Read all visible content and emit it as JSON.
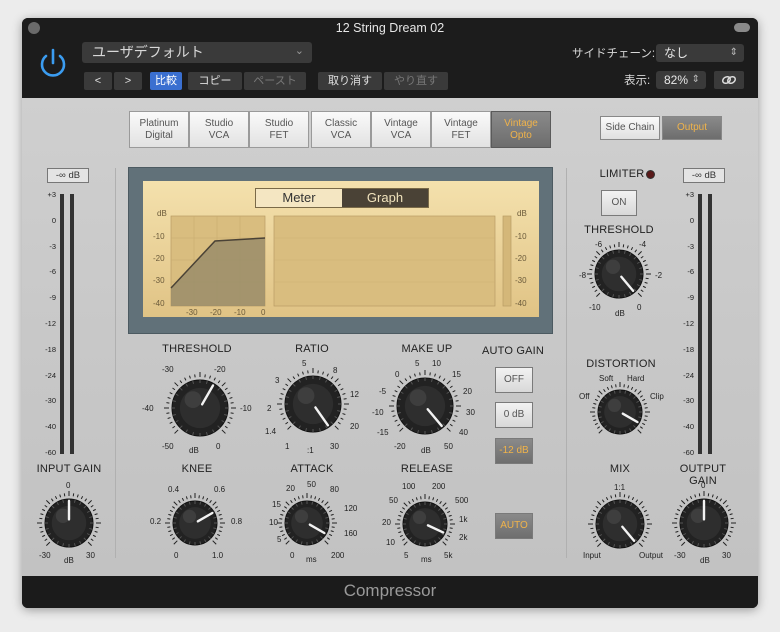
{
  "window": {
    "title": "12 String Dream 02"
  },
  "header": {
    "preset": "ユーザデフォルト",
    "compare": "比較",
    "copy": "コピー",
    "paste": "ペースト",
    "undo": "取り消す",
    "redo": "やり直す",
    "sidechain_label": "サイドチェーン:",
    "sidechain_value": "なし",
    "view_label": "表示:",
    "view_value": "82%",
    "back": "<",
    "forward": ">"
  },
  "models": [
    {
      "label": "Platinum\nDigital"
    },
    {
      "label": "Studio\nVCA"
    },
    {
      "label": "Studio\nFET"
    },
    {
      "label": "Classic\nVCA"
    },
    {
      "label": "Vintage\nVCA"
    },
    {
      "label": "Vintage\nFET"
    },
    {
      "label": "Vintage\nOpto",
      "active": true
    }
  ],
  "sidechain_tabs": {
    "left": "Side Chain",
    "right": "Output"
  },
  "input": {
    "db": "-∞ dB",
    "scale": [
      "+3",
      "0",
      "-3",
      "-6",
      "-9",
      "-12",
      "-18",
      "-24",
      "-30",
      "-40",
      "-60"
    ],
    "label": "INPUT GAIN",
    "t0": "0",
    "tmin": "-30",
    "tmax": "30",
    "unit": "dB"
  },
  "output": {
    "db": "-∞ dB",
    "scale": [
      "+3",
      "0",
      "-3",
      "-6",
      "-9",
      "-12",
      "-18",
      "-24",
      "-30",
      "-40",
      "-60"
    ],
    "label": "OUTPUT GAIN",
    "t0": "0",
    "tmin": "-30",
    "tmax": "30",
    "unit": "dB"
  },
  "display": {
    "meter_tab": "Meter",
    "graph_tab": "Graph",
    "db_left": "dB",
    "db_right": "dB",
    "y": [
      "-10",
      "-20",
      "-30",
      "-40"
    ],
    "x": [
      "-30",
      "-20",
      "-10",
      "0"
    ],
    "ry": [
      "-10",
      "-20",
      "-30",
      "-40"
    ]
  },
  "threshold": {
    "label": "THRESHOLD",
    "t1": "-30",
    "t2": "-20",
    "t3": "-40",
    "t4": "-10",
    "t5": "-50",
    "t6": "0",
    "unit": "dB"
  },
  "ratio": {
    "label": "RATIO",
    "t1": "5",
    "t2": "8",
    "t3": "3",
    "t4": "12",
    "t5": "2",
    "t6": "20",
    "t7": "1.4",
    "t8": "30",
    "t9": "1",
    "unit": ":1"
  },
  "makeup": {
    "label": "MAKE UP",
    "t1": "5",
    "t2": "10",
    "t3": "0",
    "t4": "15",
    "t5": "-5",
    "t6": "20",
    "t7": "-10",
    "t8": "30",
    "t9": "-15",
    "t10": "40",
    "t11": "-20",
    "t12": "50",
    "unit": "dB"
  },
  "autogain": {
    "label": "AUTO GAIN",
    "off": "OFF",
    "zero": "0 dB",
    "minus12": "-12 dB"
  },
  "knee": {
    "label": "KNEE",
    "t1": "0.4",
    "t2": "0.6",
    "t3": "0.2",
    "t4": "0.8",
    "t5": "0",
    "t6": "1.0"
  },
  "attack": {
    "label": "ATTACK",
    "t1": "20",
    "t2": "50",
    "t3": "80",
    "t4": "15",
    "t5": "120",
    "t6": "10",
    "t7": "160",
    "t8": "5",
    "t9": "0",
    "t10": "200",
    "unit": "ms"
  },
  "release": {
    "label": "RELEASE",
    "t1": "100",
    "t2": "200",
    "t3": "50",
    "t4": "500",
    "t5": "20",
    "t6": "1k",
    "t7": "10",
    "t8": "2k",
    "t9": "5",
    "t10": "5k",
    "unit": "ms"
  },
  "auto": {
    "label": "AUTO"
  },
  "limiter": {
    "label": "LIMITER",
    "on": "ON",
    "threshold_label": "THRESHOLD",
    "t1": "-6",
    "t2": "-4",
    "t3": "-8",
    "t4": "-2",
    "t5": "-10",
    "t6": "0",
    "unit": "dB"
  },
  "distortion": {
    "label": "DISTORTION",
    "soft": "Soft",
    "hard": "Hard",
    "off": "Off",
    "clip": "Clip"
  },
  "mix": {
    "label": "MIX",
    "top": "1:1",
    "left": "Input",
    "right": "Output"
  },
  "footer": {
    "title": "Compressor"
  }
}
